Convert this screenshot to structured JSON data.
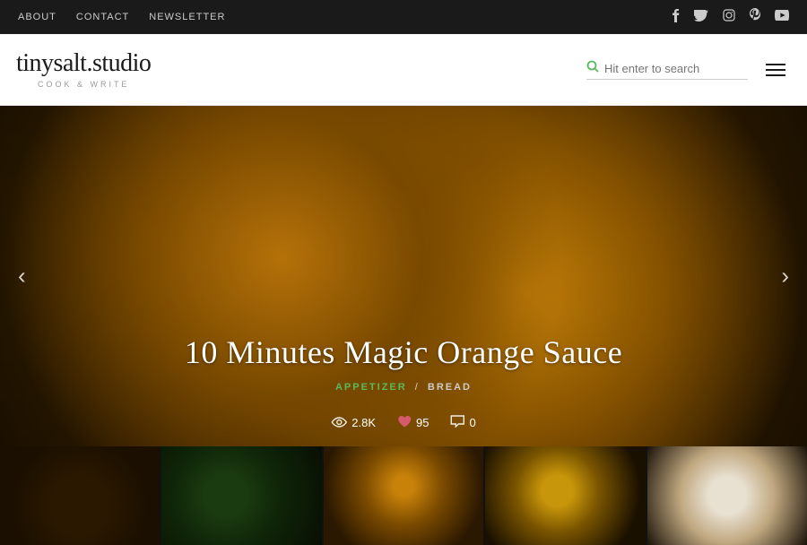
{
  "topNav": {
    "links": [
      {
        "label": "ABOUT",
        "href": "#"
      },
      {
        "label": "CONTACT",
        "href": "#"
      },
      {
        "label": "NEWSLETTER",
        "href": "#"
      }
    ],
    "socialIcons": [
      {
        "name": "facebook-icon",
        "symbol": "f"
      },
      {
        "name": "twitter-icon",
        "symbol": "t"
      },
      {
        "name": "instagram-icon",
        "symbol": "▣"
      },
      {
        "name": "pinterest-icon",
        "symbol": "p"
      },
      {
        "name": "youtube-icon",
        "symbol": "▶"
      }
    ]
  },
  "header": {
    "logoText": "tinysalt.studio",
    "tagline": "COOK & WRITE",
    "search": {
      "placeholder": "Hit enter to search"
    }
  },
  "hero": {
    "title": "10 Minutes Magic Orange Sauce",
    "category1": "APPETIZER",
    "slash": "/",
    "category2": "BREAD",
    "stats": {
      "views": "2.8K",
      "likes": "95",
      "comments": "0"
    },
    "prevArrow": "‹",
    "nextArrow": "›"
  },
  "thumbnails": [
    {
      "id": "thumb-1"
    },
    {
      "id": "thumb-2"
    },
    {
      "id": "thumb-3"
    },
    {
      "id": "thumb-4"
    },
    {
      "id": "thumb-5"
    }
  ]
}
